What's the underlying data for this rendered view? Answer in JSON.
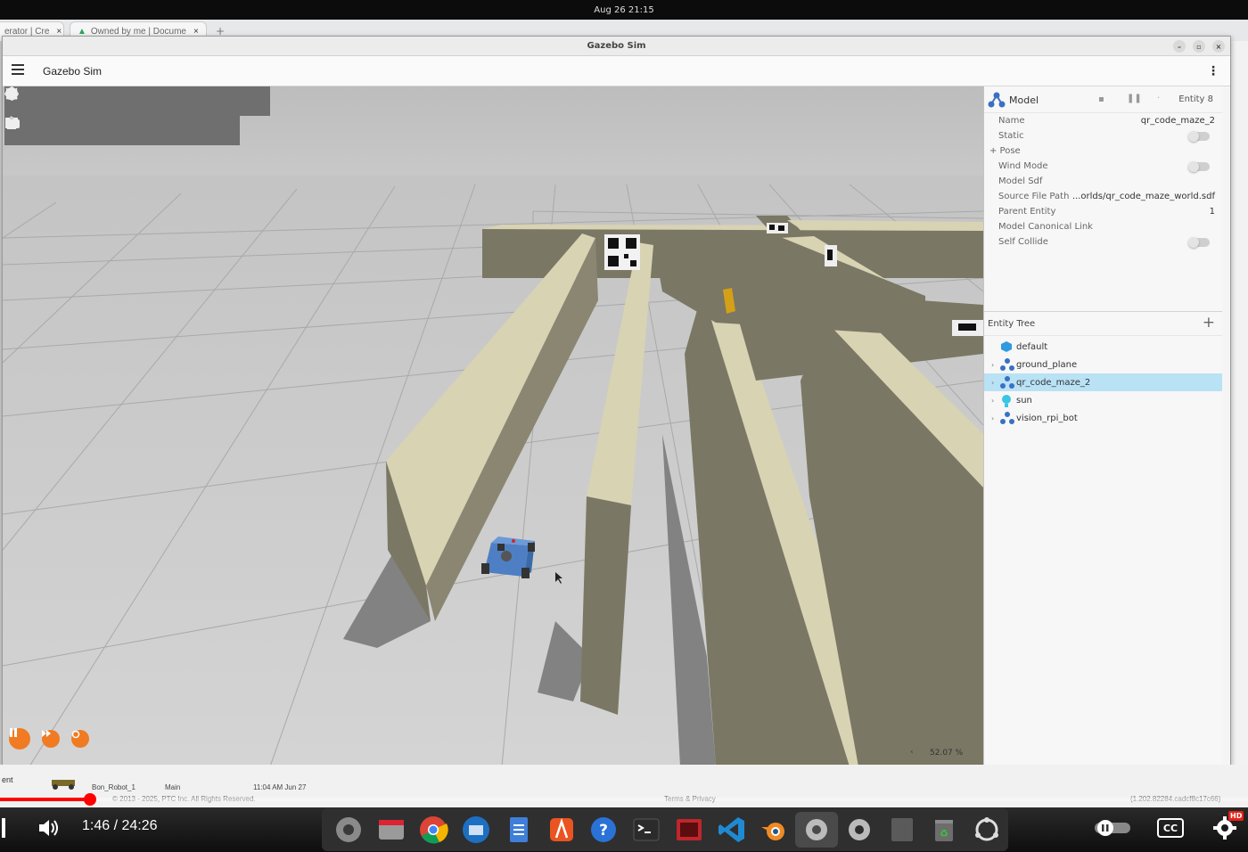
{
  "topbar": {
    "clock": "Aug 26  21:15"
  },
  "browser": {
    "tabs": [
      {
        "label": "erator | Cre"
      },
      {
        "label": "Owned by me | Docume"
      }
    ]
  },
  "window": {
    "title": "Gazebo Sim"
  },
  "app": {
    "title": "Gazebo Sim"
  },
  "toolbar": {
    "shapes": [
      "box-icon",
      "sphere-icon",
      "cone-icon",
      "cylinder-icon",
      "capsule-icon",
      "ellipsoid-icon",
      "sun-light-icon",
      "directional-light-icon",
      "spot-light-icon"
    ],
    "transform": [
      "select-arrow-icon",
      "translate-icon",
      "rotate-icon",
      "snap-icon",
      "grid-icon",
      "camera-icon",
      "copy-icon",
      "paste-icon"
    ]
  },
  "scene": {
    "zoom": "52.07 %"
  },
  "component_inspector": {
    "type_label": "Model",
    "entity_label": "Entity 8",
    "rows": [
      {
        "key": "Name",
        "value": "qr_code_maze_2"
      },
      {
        "key": "Static",
        "value": ""
      },
      {
        "key": "+ Pose",
        "value": ""
      },
      {
        "key": "Wind Mode",
        "value": ""
      },
      {
        "key": "Model Sdf",
        "value": ""
      },
      {
        "key": "Source File Path",
        "value": "...orlds/qr_code_maze_world.sdf"
      },
      {
        "key": "Parent Entity",
        "value": "1"
      },
      {
        "key": "Model Canonical Link",
        "value": ""
      },
      {
        "key": "Self Collide",
        "value": ""
      }
    ]
  },
  "entity_tree": {
    "title": "Entity Tree",
    "items": [
      {
        "label": "default",
        "selected": false
      },
      {
        "label": "ground_plane",
        "selected": false
      },
      {
        "label": "qr_code_maze_2",
        "selected": true
      },
      {
        "label": "sun",
        "selected": false
      },
      {
        "label": "vision_rpi_bot",
        "selected": false
      }
    ]
  },
  "underlying_page": {
    "row1": "Bon_Robot_1",
    "row1_user": "Main",
    "row1_date": "11:04 AM Jun 27",
    "left_label": "ent",
    "copyright": "© 2013 - 2025, PTC Inc. All Rights Reserved.",
    "terms": "Terms & Privacy",
    "version": "(1.202.82284.cadcf8c17c66)"
  },
  "video": {
    "time": "1:46 / 24:26",
    "progress_fraction": 0.072,
    "hd_badge": "HD",
    "cc_label": "CC"
  },
  "colors": {
    "accent": "#f07b22",
    "selection": "#b9e2f5",
    "progress": "#ff0000",
    "wall_side": "#7a7764",
    "wall_top": "#d8d3b3"
  }
}
